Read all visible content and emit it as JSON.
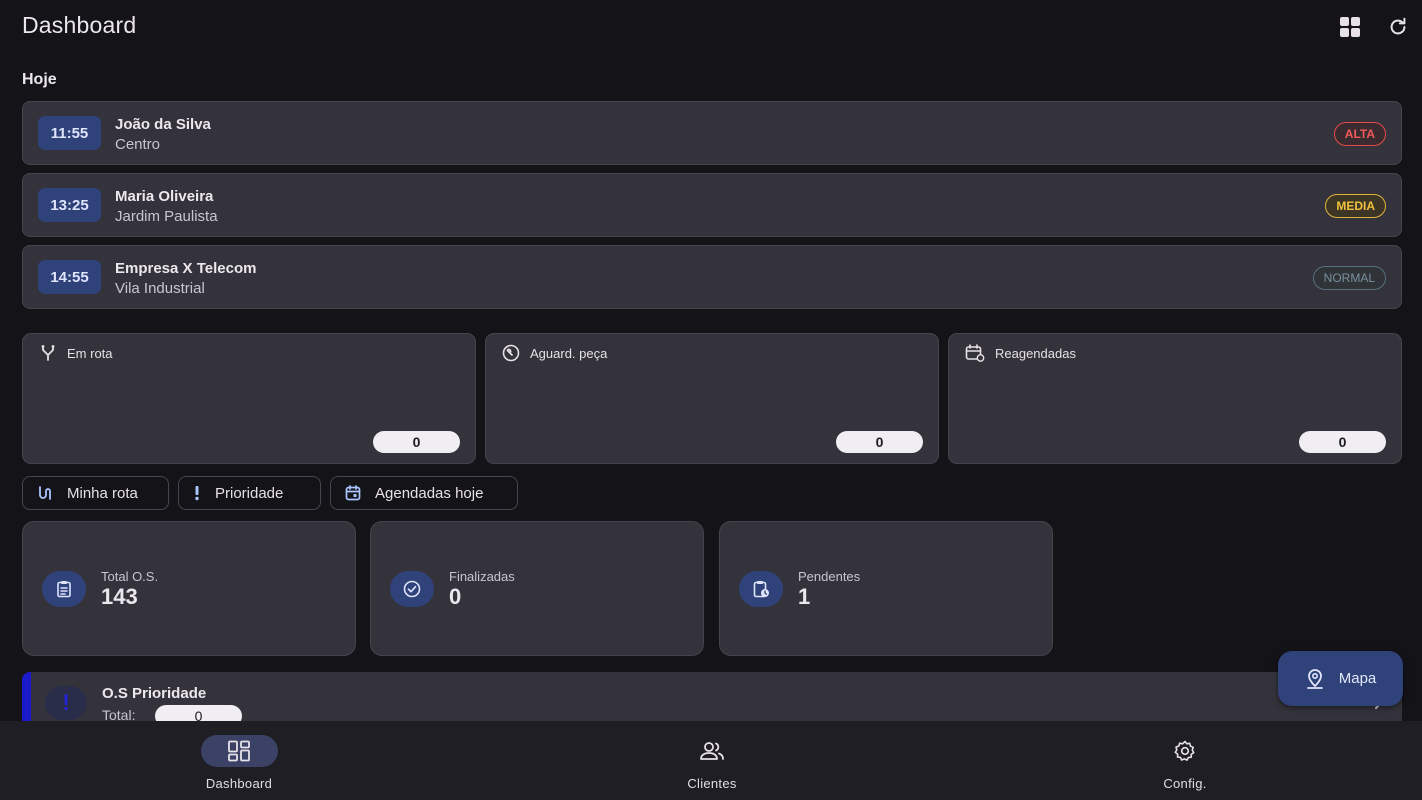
{
  "header": {
    "title": "Dashboard",
    "grid_icon": "grid-view-icon",
    "refresh_icon": "refresh-icon"
  },
  "today": {
    "title": "Hoje",
    "appointments": [
      {
        "time": "11:55",
        "name": "João da Silva",
        "place": "Centro",
        "priority": "ALTA",
        "color": "#ef5a5a"
      },
      {
        "time": "13:25",
        "name": "Maria Oliveira",
        "place": "Jardim Paulista",
        "priority": "MEDIA",
        "color": "#f0c13a"
      },
      {
        "time": "14:55",
        "name": "Empresa X Telecom",
        "place": "Vila Industrial",
        "priority": "NORMAL",
        "color": "#78909c"
      }
    ]
  },
  "status": [
    {
      "label": "Em rota",
      "count": "0",
      "icon": "fork-route-icon"
    },
    {
      "label": "Aguard. peça",
      "count": "0",
      "icon": "wrench-clock-icon"
    },
    {
      "label": "Reagendadas",
      "count": "0",
      "icon": "calendar-refresh-icon"
    }
  ],
  "filters": [
    {
      "label": "Minha rota",
      "icon": "route-icon"
    },
    {
      "label": "Prioridade",
      "icon": "exclamation-icon"
    },
    {
      "label": "Agendadas hoje",
      "icon": "calendar-icon"
    }
  ],
  "stats": [
    {
      "label": "Total O.S.",
      "value": "143",
      "icon": "clipboard-list-icon"
    },
    {
      "label": "Finalizadas",
      "value": "0",
      "icon": "check-circle-icon"
    },
    {
      "label": "Pendentes",
      "value": "1",
      "icon": "clipboard-clock-icon"
    }
  ],
  "priority_card": {
    "title": "O.S Prioridade",
    "total_label": "Total:",
    "total": "0",
    "accent": "#1a1acb"
  },
  "fab": {
    "label": "Mapa",
    "icon": "map-pin-icon"
  },
  "nav": [
    {
      "label": "Dashboard",
      "icon": "dashboard-icon",
      "active": true
    },
    {
      "label": "Clientes",
      "icon": "people-icon",
      "active": false
    },
    {
      "label": "Config.",
      "icon": "gear-icon",
      "active": false
    }
  ],
  "colors": {
    "background": "#131318",
    "card": "#34333b",
    "accent_container": "#2f4279"
  }
}
